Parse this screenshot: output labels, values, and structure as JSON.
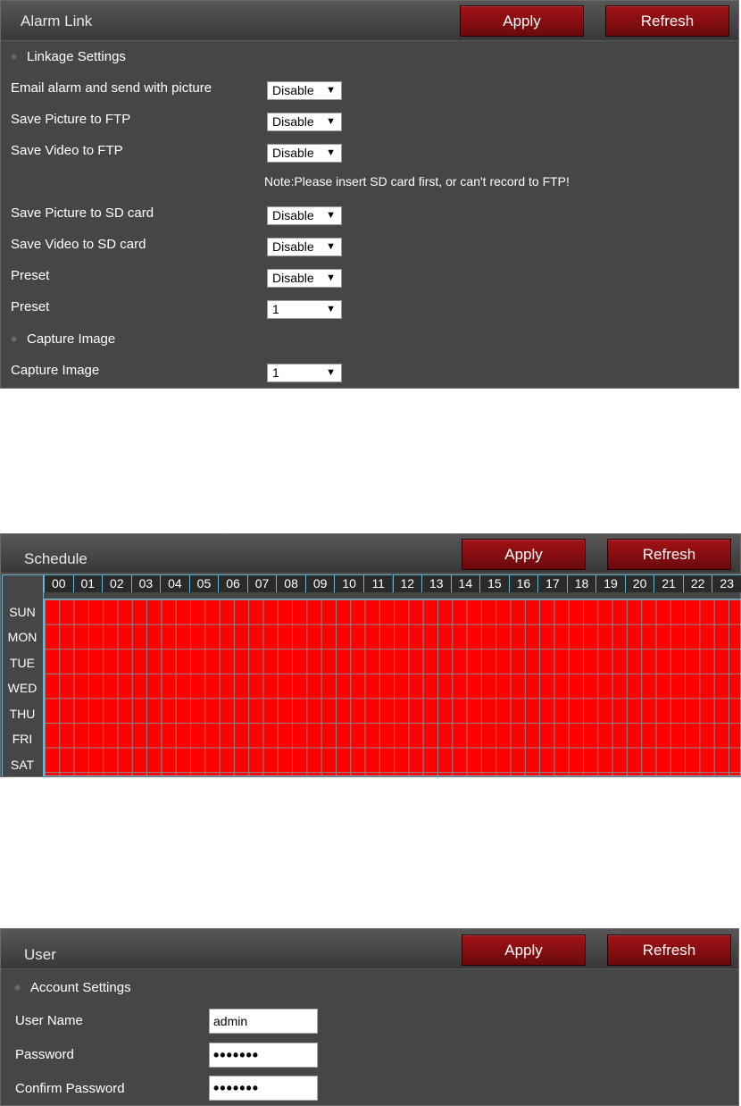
{
  "alarm": {
    "title": "Alarm Link",
    "apply": "Apply",
    "refresh": "Refresh",
    "section_linkage": "Linkage Settings",
    "rows": [
      {
        "label": "Email alarm and send with picture",
        "value": "Disable"
      },
      {
        "label": "Save Picture to FTP",
        "value": "Disable"
      },
      {
        "label": "Save Video to FTP",
        "value": "Disable"
      },
      {
        "label": "Save Picture to SD card",
        "value": "Disable"
      },
      {
        "label": "Save Video to SD card",
        "value": "Disable"
      },
      {
        "label": "Preset",
        "value": "Disable"
      },
      {
        "label": "Preset",
        "value": "1"
      }
    ],
    "note": "Note:Please insert SD card first, or can't record to FTP!",
    "section_capture": "Capture Image",
    "capture": {
      "label": "Capture Image",
      "value": "1"
    }
  },
  "schedule": {
    "title": "Schedule",
    "apply": "Apply",
    "refresh": "Refresh",
    "hours": [
      "00",
      "01",
      "02",
      "03",
      "04",
      "05",
      "06",
      "07",
      "08",
      "09",
      "10",
      "11",
      "12",
      "13",
      "14",
      "15",
      "16",
      "17",
      "18",
      "19",
      "20",
      "21",
      "22",
      "23"
    ],
    "days": [
      "SUN",
      "MON",
      "TUE",
      "WED",
      "THU",
      "FRI",
      "SAT"
    ],
    "fill_color": "#ff0000"
  },
  "user": {
    "title": "User",
    "apply": "Apply",
    "refresh": "Refresh",
    "section": "Account Settings",
    "username_label": "User Name",
    "username_value": "admin",
    "password_label": "Password",
    "password_value": "•••••••",
    "confirm_label": "Confirm Password",
    "confirm_value": "•••••••"
  },
  "icons": {
    "dropdown": "chevron-down-icon",
    "section_bullet": "diamond-bullet-icon"
  }
}
